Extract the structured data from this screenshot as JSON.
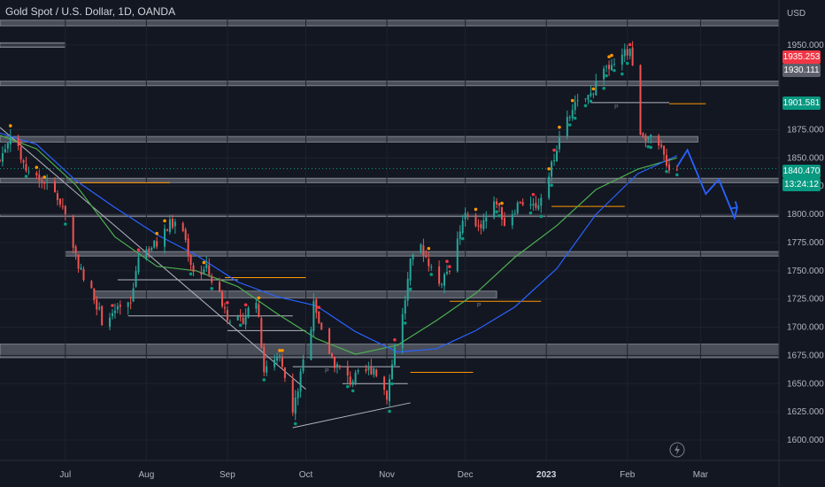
{
  "header": {
    "title": "Gold Spot / U.S. Dollar, 1D, OANDA"
  },
  "colors": {
    "background": "#131722",
    "up": "#26a69a",
    "down": "#ef5350",
    "ma_green": "#4caf50",
    "ma_blue": "#2962ff",
    "trend": "#b2b5be",
    "zone": "#787b86",
    "marker_orange": "#ff9800",
    "marker_red": "#f23645",
    "marker_green": "#089981",
    "projection": "#2962ff"
  },
  "price_tags": [
    {
      "label": "1935.253",
      "color": "#f23645"
    },
    {
      "label": "1930.111",
      "color": "#5d606b"
    },
    {
      "label": "1901.581",
      "color": "#089981"
    },
    {
      "label": "1840.470",
      "color": "#089981"
    },
    {
      "label": "13:24:12",
      "color": "#089981"
    }
  ],
  "chart_data": {
    "type": "candlestick",
    "title": "Gold Spot / U.S. Dollar, 1D, OANDA",
    "y_unit_label": "USD",
    "ylim": [
      1600,
      1975
    ],
    "yticks": [
      {
        "label": "1600.000",
        "value": 1600
      },
      {
        "label": "1625.000",
        "value": 1625
      },
      {
        "label": "1650.000",
        "value": 1650
      },
      {
        "label": "1675.000",
        "value": 1675
      },
      {
        "label": "1700.000",
        "value": 1700
      },
      {
        "label": "1725.000",
        "value": 1725
      },
      {
        "label": "1750.000",
        "value": 1750
      },
      {
        "label": "1775.000",
        "value": 1775
      },
      {
        "label": "1800.000",
        "value": 1800
      },
      {
        "label": "1825.000",
        "value": 1825
      },
      {
        "label": "1850.000",
        "value": 1850
      },
      {
        "label": "1875.000",
        "value": 1875
      },
      {
        "label": "1950.000",
        "value": 1950
      }
    ],
    "xlim": [
      "2022-06-06",
      "2023-03-31"
    ],
    "xticks": [
      {
        "label": "Jul",
        "date": "2022-07-01"
      },
      {
        "label": "Aug",
        "date": "2022-08-01"
      },
      {
        "label": "Sep",
        "date": "2022-09-01"
      },
      {
        "label": "Oct",
        "date": "2022-10-01"
      },
      {
        "label": "Nov",
        "date": "2022-11-01"
      },
      {
        "label": "Dec",
        "date": "2022-12-01"
      },
      {
        "label": "2023",
        "date": "2023-01-01",
        "bold": true
      },
      {
        "label": "Feb",
        "date": "2023-02-01"
      },
      {
        "label": "Mar",
        "date": "2023-03-01"
      }
    ],
    "close_path": [
      [
        "2022-06-06",
        1848
      ],
      [
        "2022-06-10",
        1872
      ],
      [
        "2022-06-16",
        1840
      ],
      [
        "2022-06-24",
        1826
      ],
      [
        "2022-06-30",
        1808
      ],
      [
        "2022-07-05",
        1764
      ],
      [
        "2022-07-08",
        1742
      ],
      [
        "2022-07-12",
        1728
      ],
      [
        "2022-07-15",
        1706
      ],
      [
        "2022-07-19",
        1712
      ],
      [
        "2022-07-21",
        1714
      ],
      [
        "2022-07-26",
        1720
      ],
      [
        "2022-07-29",
        1765
      ],
      [
        "2022-08-05",
        1774
      ],
      [
        "2022-08-10",
        1792
      ],
      [
        "2022-08-15",
        1786
      ],
      [
        "2022-08-19",
        1748
      ],
      [
        "2022-08-24",
        1752
      ],
      [
        "2022-08-29",
        1728
      ],
      [
        "2022-09-01",
        1710
      ],
      [
        "2022-09-06",
        1704
      ],
      [
        "2022-09-12",
        1726
      ],
      [
        "2022-09-15",
        1662
      ],
      [
        "2022-09-21",
        1672
      ],
      [
        "2022-09-26",
        1624
      ],
      [
        "2022-09-28",
        1646
      ],
      [
        "2022-10-03",
        1702
      ],
      [
        "2022-10-04",
        1726
      ],
      [
        "2022-10-07",
        1694
      ],
      [
        "2022-10-12",
        1668
      ],
      [
        "2022-10-18",
        1652
      ],
      [
        "2022-10-21",
        1657
      ],
      [
        "2022-10-27",
        1664
      ],
      [
        "2022-11-01",
        1640
      ],
      [
        "2022-11-04",
        1682
      ],
      [
        "2022-11-07",
        1710
      ],
      [
        "2022-11-10",
        1756
      ],
      [
        "2022-11-14",
        1772
      ],
      [
        "2022-11-21",
        1738
      ],
      [
        "2022-11-25",
        1754
      ],
      [
        "2022-12-01",
        1800
      ],
      [
        "2022-12-05",
        1786
      ],
      [
        "2022-12-09",
        1797
      ],
      [
        "2022-12-13",
        1812
      ],
      [
        "2022-12-16",
        1792
      ],
      [
        "2022-12-22",
        1812
      ],
      [
        "2022-12-28",
        1804
      ],
      [
        "2023-01-04",
        1852
      ],
      [
        "2023-01-06",
        1868
      ],
      [
        "2023-01-12",
        1896
      ],
      [
        "2023-01-18",
        1906
      ],
      [
        "2023-01-23",
        1932
      ],
      [
        "2023-01-26",
        1928
      ],
      [
        "2023-02-02",
        1947
      ],
      [
        "2023-02-06",
        1874
      ],
      [
        "2023-02-10",
        1866
      ],
      [
        "2023-02-14",
        1856
      ],
      [
        "2023-02-17",
        1842
      ],
      [
        "2023-02-20",
        1840.47
      ]
    ],
    "ma_green_path": [
      [
        "2022-06-06",
        1870
      ],
      [
        "2022-06-20",
        1858
      ],
      [
        "2022-07-05",
        1826
      ],
      [
        "2022-07-20",
        1780
      ],
      [
        "2022-08-05",
        1754
      ],
      [
        "2022-08-20",
        1750
      ],
      [
        "2022-09-05",
        1736
      ],
      [
        "2022-09-20",
        1712
      ],
      [
        "2022-10-05",
        1690
      ],
      [
        "2022-10-20",
        1676
      ],
      [
        "2022-11-05",
        1684
      ],
      [
        "2022-11-20",
        1706
      ],
      [
        "2022-12-05",
        1730
      ],
      [
        "2022-12-20",
        1762
      ],
      [
        "2023-01-05",
        1790
      ],
      [
        "2023-01-20",
        1822
      ],
      [
        "2023-02-05",
        1840
      ],
      [
        "2023-02-20",
        1850
      ]
    ],
    "ma_blue_path": [
      [
        "2022-06-06",
        1872
      ],
      [
        "2022-06-20",
        1862
      ],
      [
        "2022-07-05",
        1830
      ],
      [
        "2022-07-20",
        1806
      ],
      [
        "2022-08-05",
        1782
      ],
      [
        "2022-08-20",
        1764
      ],
      [
        "2022-09-05",
        1740
      ],
      [
        "2022-09-20",
        1727
      ],
      [
        "2022-10-05",
        1719
      ],
      [
        "2022-10-20",
        1696
      ],
      [
        "2022-11-05",
        1678
      ],
      [
        "2022-11-20",
        1681
      ],
      [
        "2022-12-05",
        1697
      ],
      [
        "2022-12-20",
        1718
      ],
      [
        "2023-01-05",
        1752
      ],
      [
        "2023-01-20",
        1800
      ],
      [
        "2023-02-05",
        1836
      ],
      [
        "2023-02-20",
        1852
      ]
    ],
    "trendlines": [
      {
        "from": [
          "2022-06-06",
          1877
        ],
        "to": [
          "2022-10-01",
          1645
        ]
      },
      {
        "from": [
          "2022-09-26",
          1611
        ],
        "to": [
          "2022-11-10",
          1633
        ]
      }
    ],
    "zones": [
      {
        "from": "2022-06-06",
        "to": "2023-03-31",
        "low": 1967,
        "high": 1972
      },
      {
        "from": "2022-06-06",
        "to": "2022-07-01",
        "low": 1948,
        "high": 1952
      },
      {
        "from": "2022-06-06",
        "to": "2023-03-31",
        "low": 1914,
        "high": 1918
      },
      {
        "from": "2022-06-06",
        "to": "2023-02-28",
        "low": 1864,
        "high": 1869
      },
      {
        "from": "2022-06-06",
        "to": "2023-03-31",
        "low": 1828,
        "high": 1832
      },
      {
        "from": "2022-06-06",
        "to": "2023-03-31",
        "low": 1798,
        "high": 1800
      },
      {
        "from": "2022-07-01",
        "to": "2023-03-31",
        "low": 1763,
        "high": 1767
      },
      {
        "from": "2022-07-12",
        "to": "2022-12-13",
        "low": 1726,
        "high": 1732
      },
      {
        "from": "2022-06-06",
        "to": "2023-03-31",
        "low": 1673,
        "high": 1685
      }
    ],
    "pivot_lines": [
      {
        "from": "2022-07-25",
        "to": "2022-09-26",
        "value": 1710,
        "color": "#b2b5be",
        "p_label": ""
      },
      {
        "from": "2022-07-21",
        "to": "2022-09-05",
        "value": 1742,
        "color": "#b2b5be",
        "p_label": ""
      },
      {
        "from": "2022-07-05",
        "to": "2022-08-10",
        "value": 1828,
        "color": "#ff9800",
        "p_label": ""
      },
      {
        "from": "2022-08-31",
        "to": "2022-10-01",
        "value": 1744,
        "color": "#ff9800",
        "p_label": ""
      },
      {
        "from": "2022-09-01",
        "to": "2022-10-01",
        "value": 1697,
        "color": "#b2b5be",
        "p_label": ""
      },
      {
        "from": "2022-09-26",
        "to": "2022-11-06",
        "value": 1665,
        "color": "#b2b5be",
        "p_label": "P"
      },
      {
        "from": "2022-11-10",
        "to": "2022-12-04",
        "value": 1660,
        "color": "#ff9800",
        "p_label": ""
      },
      {
        "from": "2022-10-15",
        "to": "2022-11-09",
        "value": 1650,
        "color": "#b2b5be",
        "p_label": ""
      },
      {
        "from": "2022-11-25",
        "to": "2022-12-30",
        "value": 1723,
        "color": "#ff9800",
        "p_label": "P"
      },
      {
        "from": "2023-01-03",
        "to": "2023-01-31",
        "value": 1807,
        "color": "#ff9800",
        "p_label": ""
      },
      {
        "from": "2023-01-18",
        "to": "2023-02-17",
        "value": 1899,
        "color": "#b2b5be",
        "p_label": "P"
      },
      {
        "from": "2023-02-17",
        "to": "2023-03-03",
        "value": 1898,
        "color": "#ff9800",
        "p_label": ""
      }
    ],
    "projection_path": [
      [
        "2023-02-20",
        1842
      ],
      [
        "2023-02-24",
        1857
      ],
      [
        "2023-03-03",
        1818
      ],
      [
        "2023-03-08",
        1831
      ],
      [
        "2023-03-14",
        1797
      ],
      [
        "2023-03-15",
        1806
      ]
    ]
  }
}
